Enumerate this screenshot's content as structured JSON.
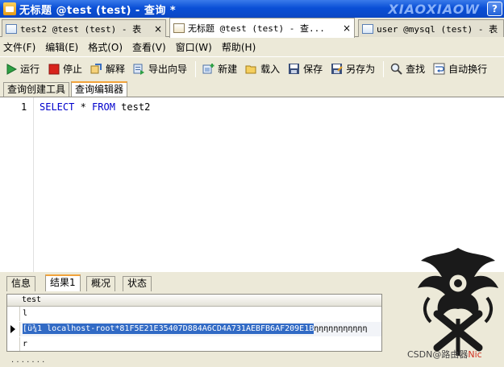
{
  "window": {
    "title": "无标题 @test (test) - 查询 *",
    "brand": "XIAOXIAOW",
    "help_label": "?"
  },
  "doc_tabs": [
    {
      "label": "test2 @test (test) - 表",
      "close": "×"
    },
    {
      "label": "无标题 @test (test) - 查...",
      "close": "×"
    },
    {
      "label": "user @mysql (test) - 表",
      "close": ""
    }
  ],
  "menu": [
    "文件(F)",
    "编辑(E)",
    "格式(O)",
    "查看(V)",
    "窗口(W)",
    "帮助(H)"
  ],
  "toolbar": {
    "run": "运行",
    "stop": "停止",
    "explain": "解释",
    "export_wizard": "导出向导",
    "new": "新建",
    "load": "载入",
    "save": "保存",
    "save_as": "另存为",
    "find": "查找",
    "auto_wrap": "自动换行"
  },
  "sub_tabs": [
    "查询创建工具",
    "查询编辑器"
  ],
  "editor": {
    "line_number": "1",
    "kw_select": "SELECT",
    "star": " * ",
    "kw_from": "FROM",
    "table": " test2"
  },
  "result_tabs": [
    "信息",
    "结果1",
    "概况",
    "状态"
  ],
  "grid": {
    "column": "test",
    "rows": [
      "l",
      "[ü¾1   localhost-root*81F5E21E35407D884A6CD4A731AEBFB6AF209E1B",
      "r"
    ],
    "selected_tail": "ηηηηηηηηηηη"
  },
  "status_text": "· · · · · · ·",
  "watermark": {
    "prefix": "CSDN",
    "text": "@路由器",
    "suffix": "Nic"
  },
  "icons": [
    "run-icon",
    "stop-icon",
    "explain-icon",
    "export-icon",
    "new-icon",
    "load-icon",
    "save-icon",
    "save-as-icon",
    "find-icon",
    "wrap-icon"
  ],
  "colors": {
    "title_blue": "#0a4fd6",
    "selection": "#316ac5",
    "keyword": "#0000cc",
    "tab_accent": "#f2a33a"
  }
}
